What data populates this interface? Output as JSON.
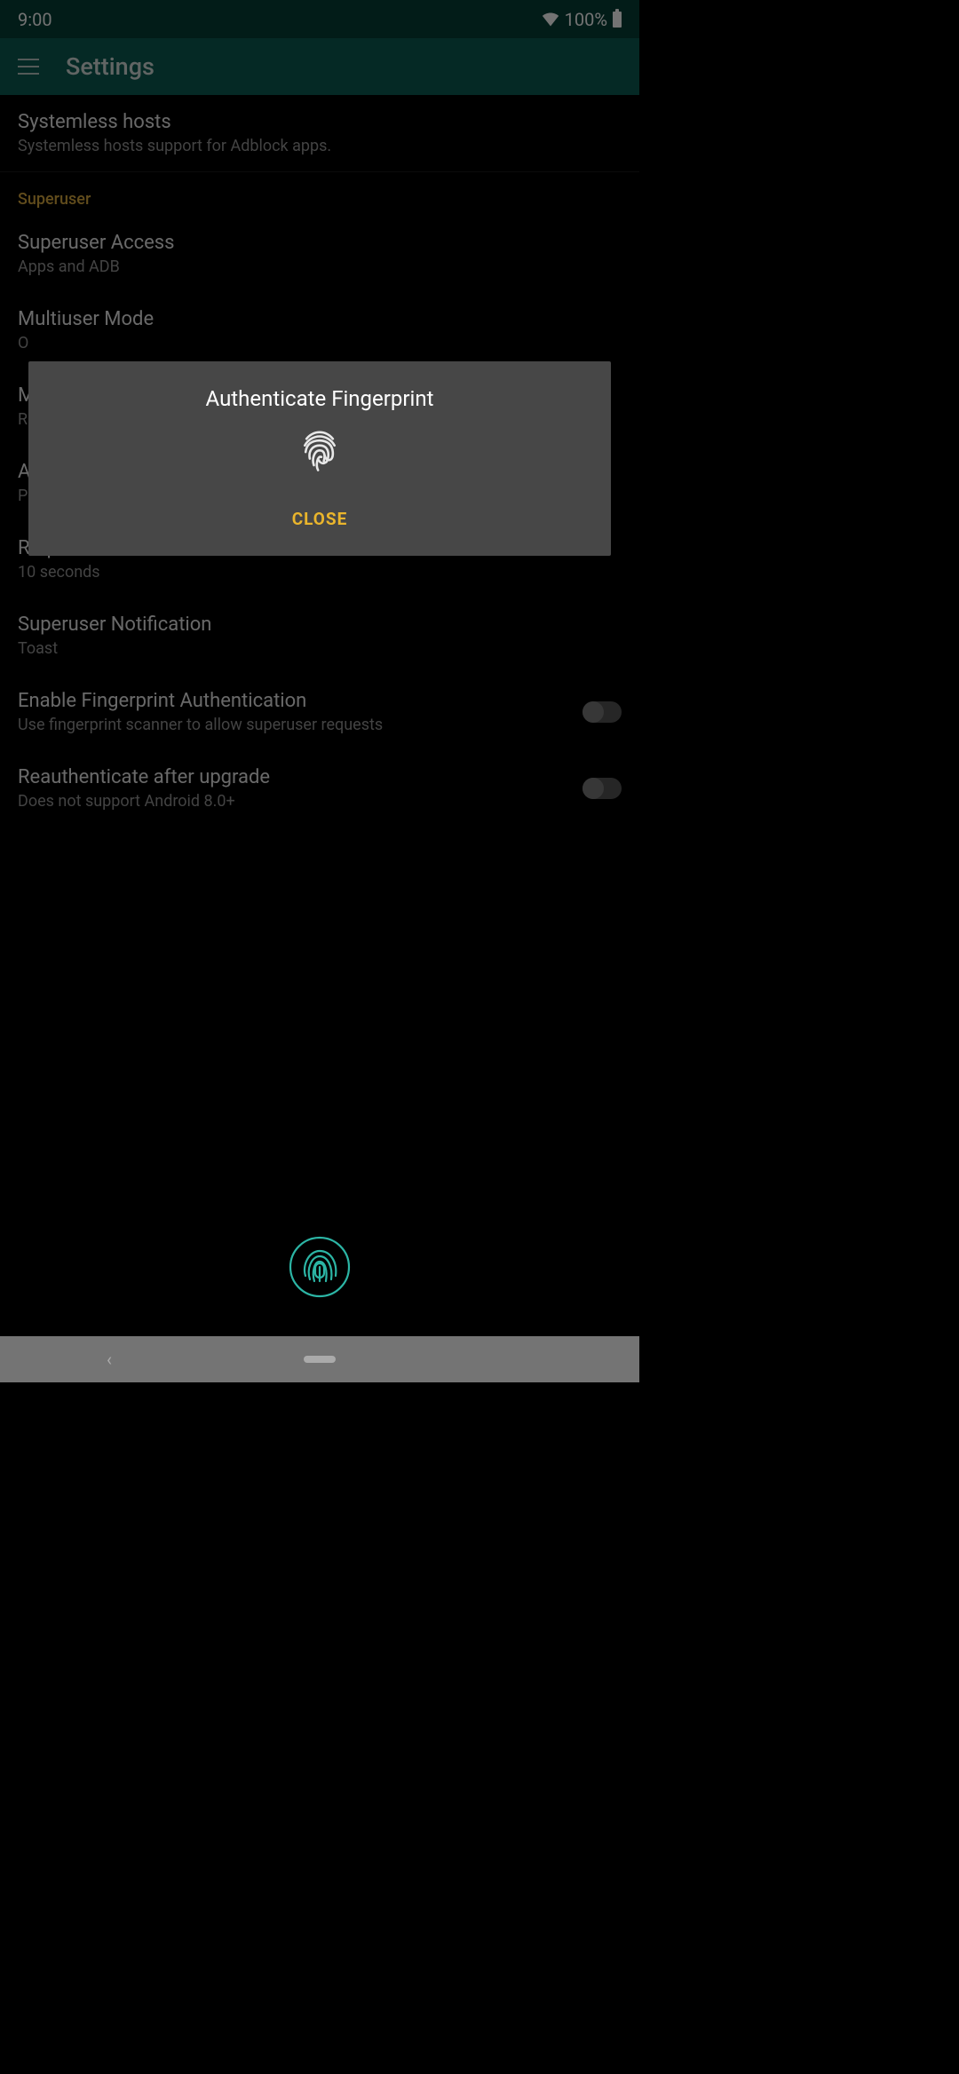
{
  "status": {
    "time": "9:00",
    "battery": "100%"
  },
  "header": {
    "title": "Settings"
  },
  "settings": {
    "systemless_hosts": {
      "title": "Systemless hosts",
      "subtitle": "Systemless hosts support for Adblock apps."
    },
    "section_superuser": "Superuser",
    "superuser_access": {
      "title": "Superuser Access",
      "subtitle": "Apps and ADB"
    },
    "multiuser_mode": {
      "title": "Multiuser Mode",
      "subtitle": "O"
    },
    "m_item": {
      "title": "M",
      "subtitle": "R"
    },
    "a_item": {
      "title": "A",
      "subtitle": "P"
    },
    "request_timeout": {
      "title": "Request Timeout",
      "subtitle": "10 seconds"
    },
    "superuser_notification": {
      "title": "Superuser Notification",
      "subtitle": "Toast"
    },
    "enable_fingerprint": {
      "title": "Enable Fingerprint Authentication",
      "subtitle": "Use fingerprint scanner to allow superuser requests",
      "enabled": false
    },
    "reauthenticate": {
      "title": "Reauthenticate after upgrade",
      "subtitle": "Does not support Android 8.0+",
      "enabled": false
    }
  },
  "dialog": {
    "title": "Authenticate Fingerprint",
    "close": "CLOSE"
  }
}
